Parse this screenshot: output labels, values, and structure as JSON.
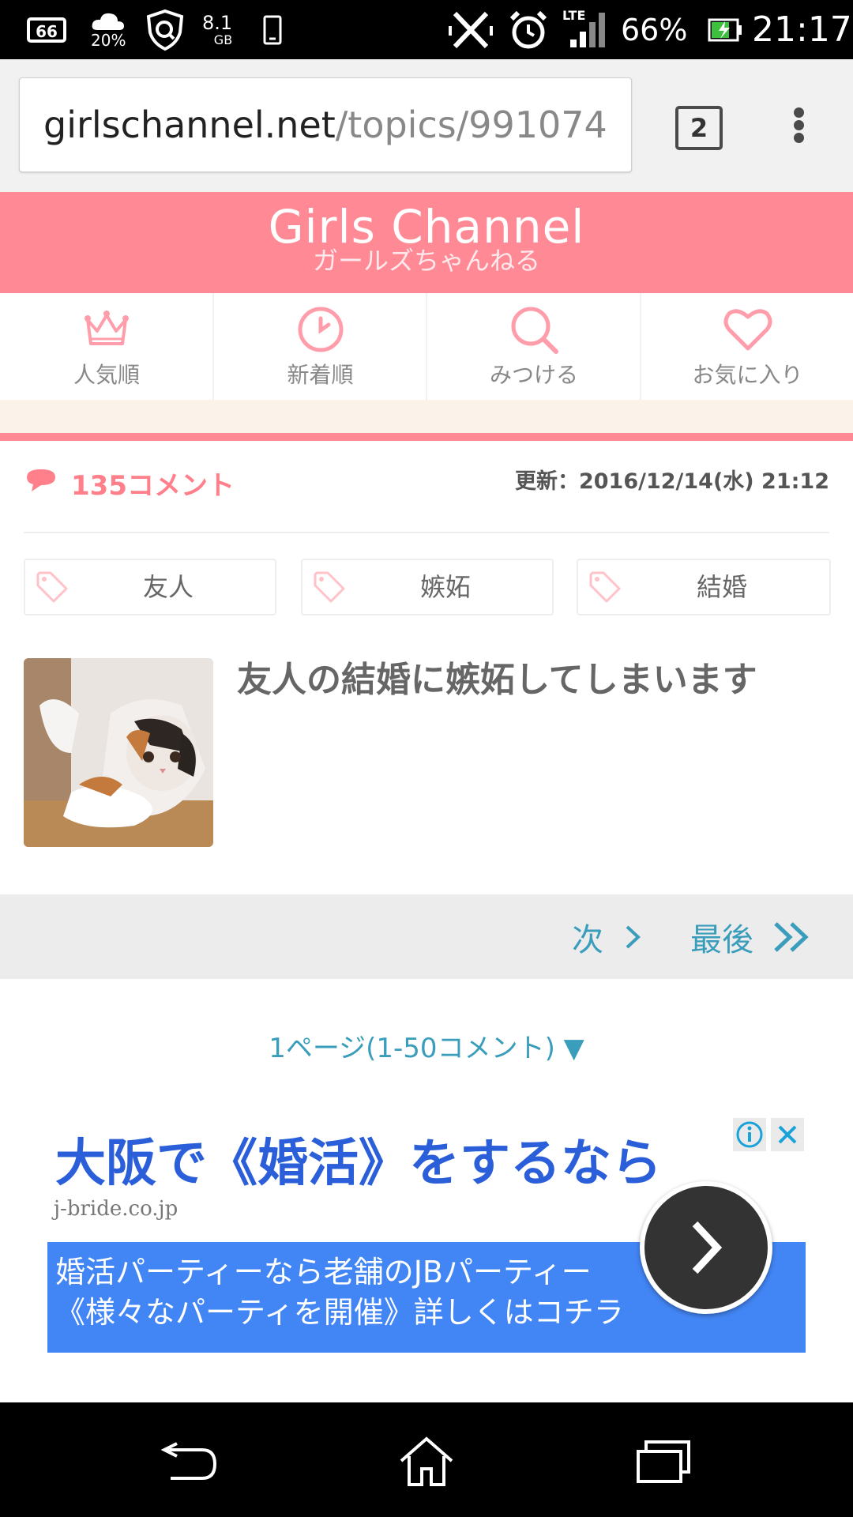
{
  "status_bar": {
    "cloud_percent": "20%",
    "storage_value": "8.1",
    "storage_unit": "GB",
    "network": "LTE",
    "battery": "66%",
    "time": "21:17"
  },
  "browser": {
    "url_domain": "girlschannel.net",
    "url_path": "/topics/991074",
    "tab_count": "2"
  },
  "site": {
    "logo": "Girls Channel",
    "logo_sub": "ガールズちゃんねる"
  },
  "nav": [
    {
      "label": "人気順",
      "icon": "crown-icon"
    },
    {
      "label": "新着順",
      "icon": "clock-icon"
    },
    {
      "label": "みつける",
      "icon": "search-icon"
    },
    {
      "label": "お気に入り",
      "icon": "heart-icon"
    }
  ],
  "topic": {
    "comment_count": "135コメント",
    "updated": "更新：2016/12/14(水) 21:12",
    "tags": [
      "友人",
      "嫉妬",
      "結婚"
    ],
    "title": "友人の結婚に嫉妬してしまいます"
  },
  "pager": {
    "next": "次",
    "last": "最後",
    "page_select": "1ページ(1-50コメント) ▼"
  },
  "ad": {
    "title": "大阪で《婚活》をするなら",
    "domain": "j-bride.co.jp",
    "line1": "婚活パーティーなら老舗のJBパーティー",
    "line2": "《様々なパーティを開催》詳しくはコチラ"
  },
  "colors": {
    "brand_pink": "#ff8a95",
    "link_blue": "#3a9dbb",
    "ad_blue": "#4285f4"
  }
}
